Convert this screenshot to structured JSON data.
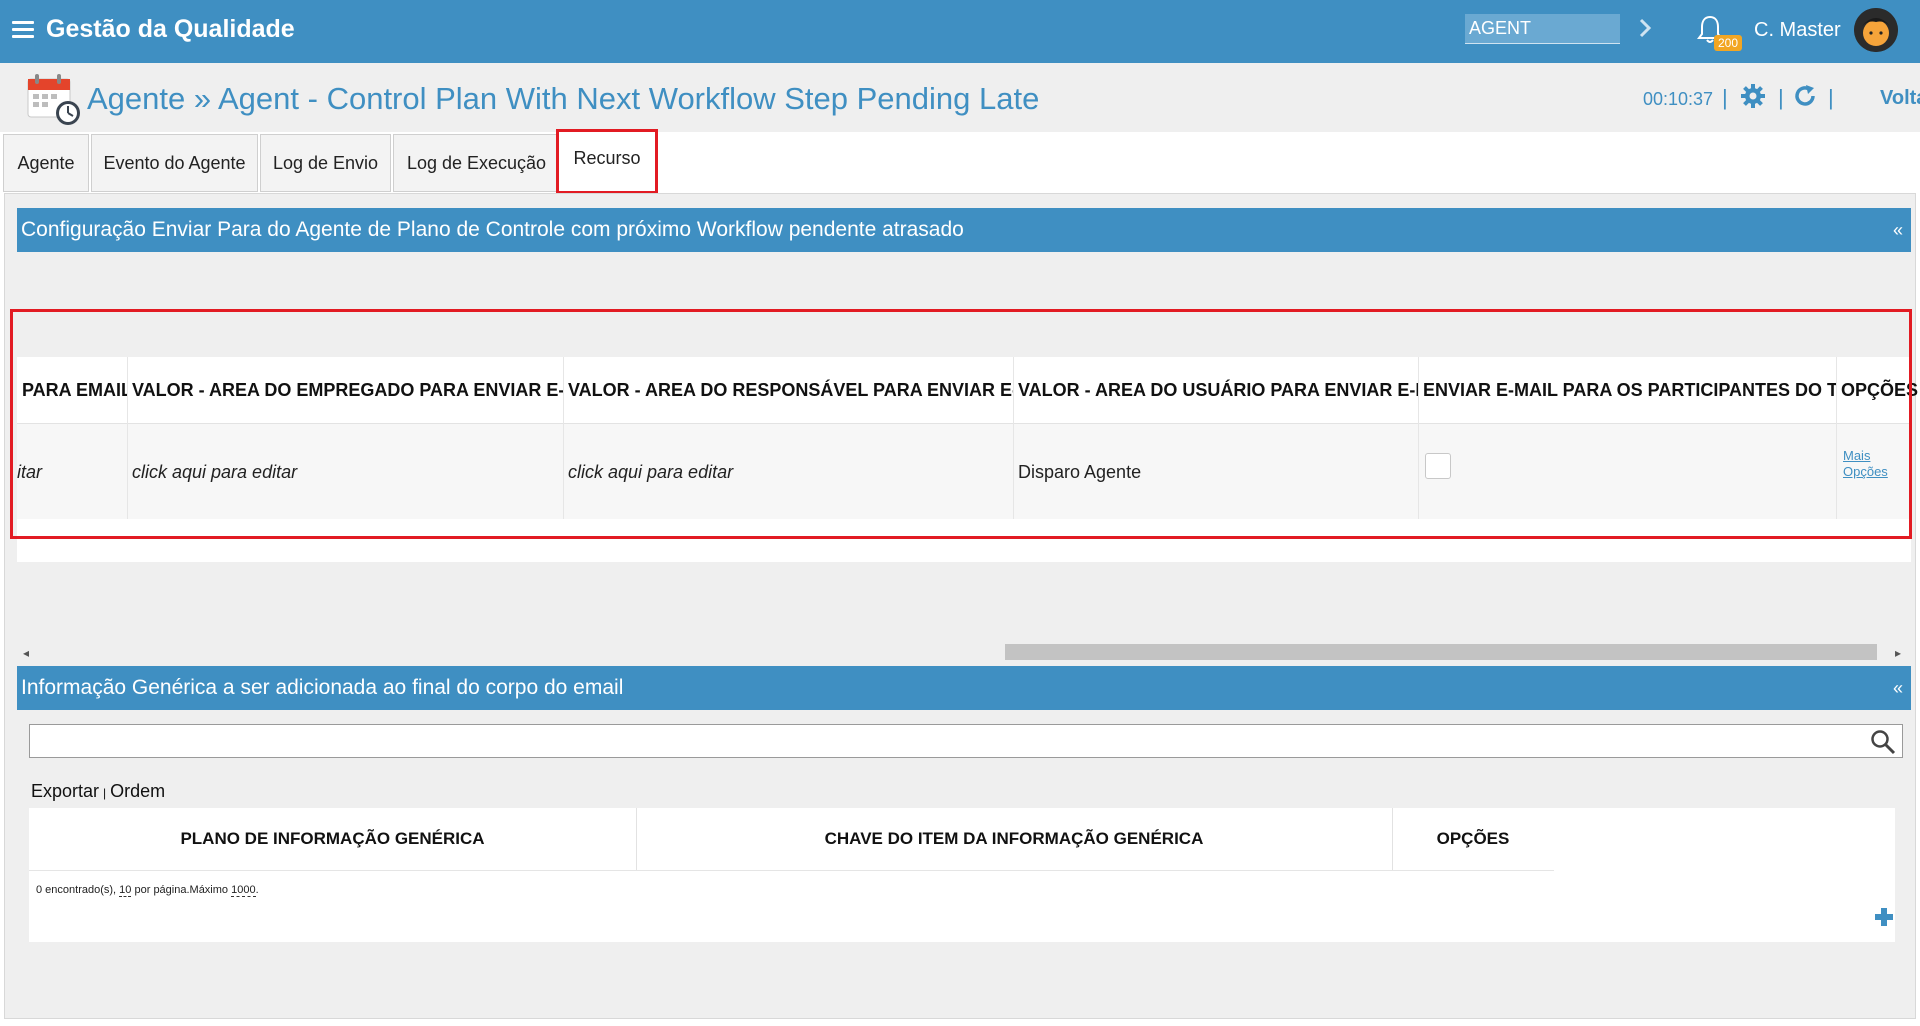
{
  "topbar": {
    "app_title": "Gestão da Qualidade",
    "agent_value": "AGENT",
    "notifications_count": "200",
    "user_name": "C. Master"
  },
  "header": {
    "page_title": "Agente » Agent - Control Plan With Next Workflow Step Pending Late",
    "timer": "00:10:37",
    "voltar": "Voltar"
  },
  "tabs": [
    {
      "label": "Agente"
    },
    {
      "label": "Evento do Agente"
    },
    {
      "label": "Log de Envio"
    },
    {
      "label": "Log de Execução"
    },
    {
      "label": "Recurso"
    }
  ],
  "section1": {
    "title": "Configuração Enviar Para do Agente de Plano de Controle com próximo Workflow pendente atrasado",
    "collapse": "«",
    "columns": [
      "PARA EMAIL",
      "VALOR - AREA DO EMPREGADO PARA ENVIAR E-MAIL",
      "VALOR - AREA DO RESPONSÁVEL PARA ENVIAR E-MAIL",
      "VALOR - AREA DO USUÁRIO PARA ENVIAR E-MAIL",
      "ENVIAR E-MAIL PARA OS PARTICIPANTES DO TIME",
      "OPÇÕES"
    ],
    "row": {
      "c0": "itar",
      "c1": "click aqui para editar",
      "c2": "click aqui para editar",
      "c3": "Disparo Agente",
      "mais_line1": "Mais",
      "mais_line2": "Opções"
    }
  },
  "section2": {
    "title": "Informação Genérica a ser adicionada ao final do corpo do email",
    "collapse": "«",
    "export": "Exportar",
    "order": "Ordem",
    "columns": [
      "PLANO DE INFORMAÇÃO GENÉRICA",
      "CHAVE DO ITEM DA INFORMAÇÃO GENÉRICA",
      "OPÇÕES"
    ],
    "footer_found": "0 encontrado(s),",
    "footer_per_page_num": "10",
    "footer_per_page": "por página.Máximo",
    "footer_max": "1000",
    "footer_end": "."
  },
  "colors": {
    "primary": "#3f8fc2",
    "highlight": "#e21b23",
    "badge": "#f2a623"
  }
}
